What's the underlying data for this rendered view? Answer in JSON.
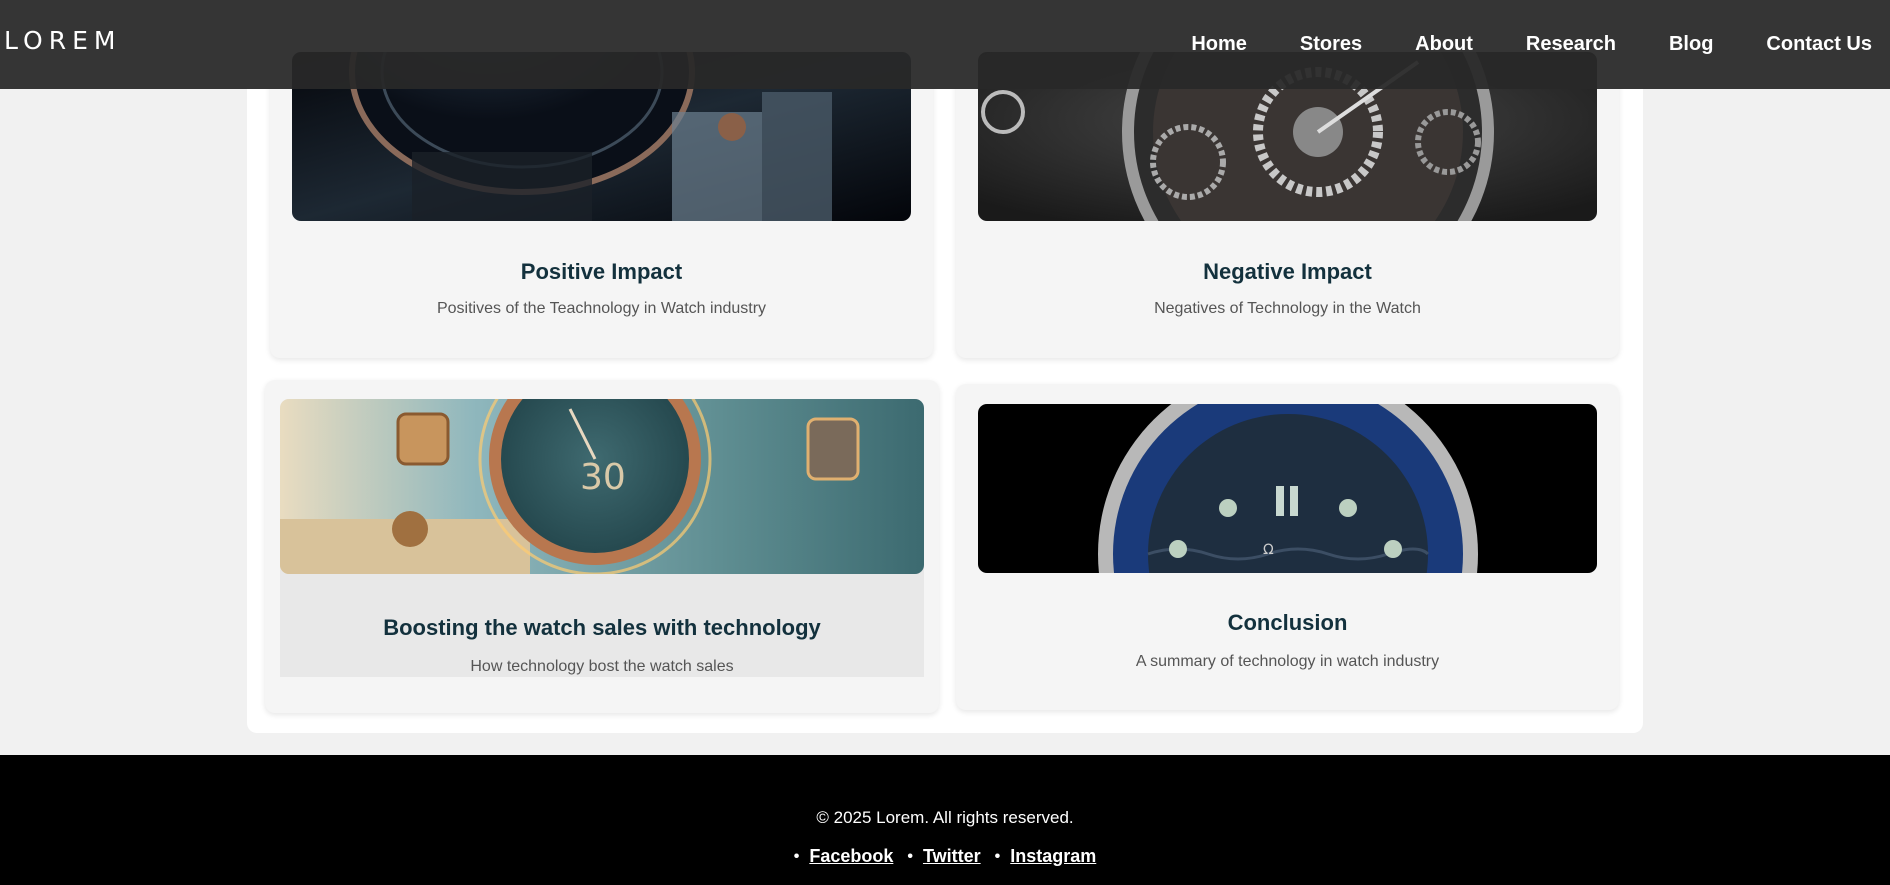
{
  "header": {
    "logo": "LOREM",
    "nav": [
      "Home",
      "Stores",
      "About",
      "Research",
      "Blog",
      "Contact Us"
    ]
  },
  "cards": [
    {
      "title": "Positive Impact",
      "description": "Positives of the Teachnology in Watch industry",
      "image": "dark-steel-watch-closeup"
    },
    {
      "title": "Negative Impact",
      "description": "Negatives of Technology in the Watch",
      "image": "skeleton-watch-gears"
    },
    {
      "title": "Boosting the watch sales with technology",
      "description": "How technology bost the watch sales",
      "image": "glowing-bronze-watch-beach"
    },
    {
      "title": "Conclusion",
      "description": "A summary of technology in watch industry",
      "image": "omega-blue-dive-watch"
    }
  ],
  "footer": {
    "copyright": "© 2025 Lorem. All rights reserved.",
    "social": [
      "Facebook",
      "Twitter",
      "Instagram"
    ]
  },
  "colors": {
    "header_bg": "#282828",
    "page_bg": "#f1f1f1",
    "card_bg": "#f5f5f5",
    "title": "#13313d",
    "footer_bg": "#000000"
  }
}
